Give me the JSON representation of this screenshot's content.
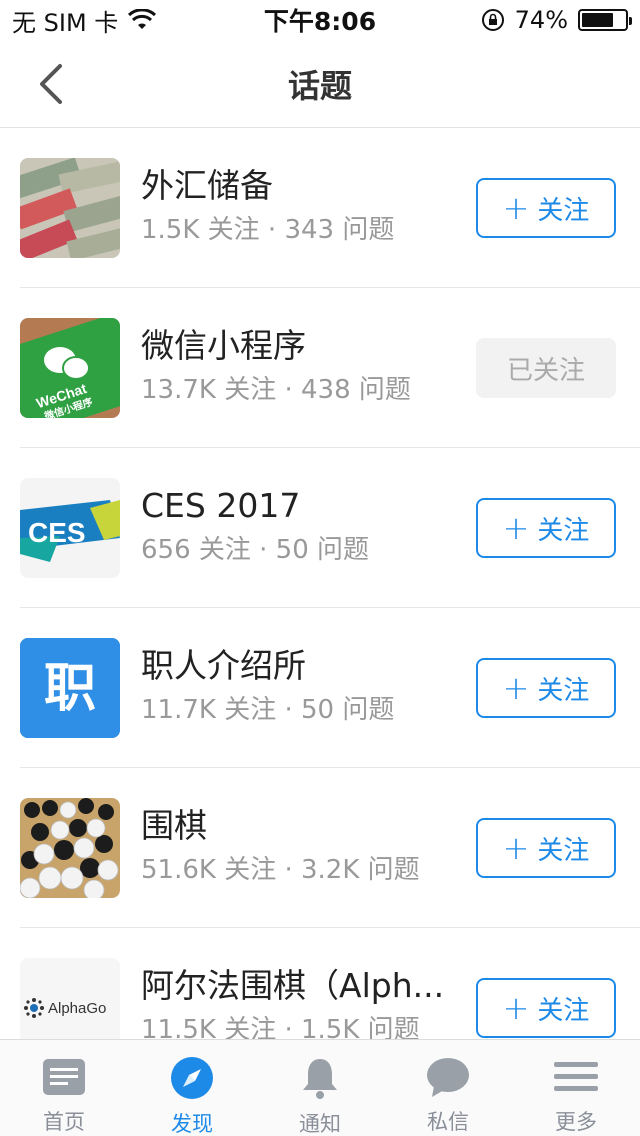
{
  "status_bar": {
    "carrier": "无 SIM 卡",
    "time": "下午8:06",
    "battery": "74%",
    "battery_level": 0.74
  },
  "nav": {
    "title": "话题",
    "back_icon": "chevron-left-icon"
  },
  "colors": {
    "accent": "#1e8ae8",
    "meta_text": "#999999",
    "followed_bg": "#f2f2f2"
  },
  "topics": [
    {
      "name": "外汇储备",
      "meta": "1.5K 关注 · 343 问题",
      "button": "关注",
      "followed": false
    },
    {
      "name": "微信小程序",
      "meta": "13.7K 关注 · 438 问题",
      "button": "已关注",
      "followed": true
    },
    {
      "name": "CES 2017",
      "meta": "656 关注 · 50 问题",
      "button": "关注",
      "followed": false
    },
    {
      "name": "职人介绍所",
      "meta": "11.7K 关注 · 50 问题",
      "button": "关注",
      "followed": false
    },
    {
      "name": "围棋",
      "meta": "51.6K 关注 · 3.2K 问题",
      "button": "关注",
      "followed": false
    },
    {
      "name": "阿尔法围棋（Alph...",
      "meta": "11.5K 关注 · 1.5K 问题",
      "button": "关注",
      "followed": false
    }
  ],
  "thumb_text": {
    "wechat": "WeChat",
    "wechat_sub": "微信小程序",
    "ces": "CES",
    "zhiren": "职",
    "alphago": "AlphaGo"
  },
  "tabs": [
    {
      "label": "首页",
      "icon": "home-feed-icon",
      "active": false
    },
    {
      "label": "发现",
      "icon": "compass-icon",
      "active": true
    },
    {
      "label": "通知",
      "icon": "bell-icon",
      "active": false
    },
    {
      "label": "私信",
      "icon": "chat-bubble-icon",
      "active": false
    },
    {
      "label": "更多",
      "icon": "menu-icon",
      "active": false
    }
  ]
}
